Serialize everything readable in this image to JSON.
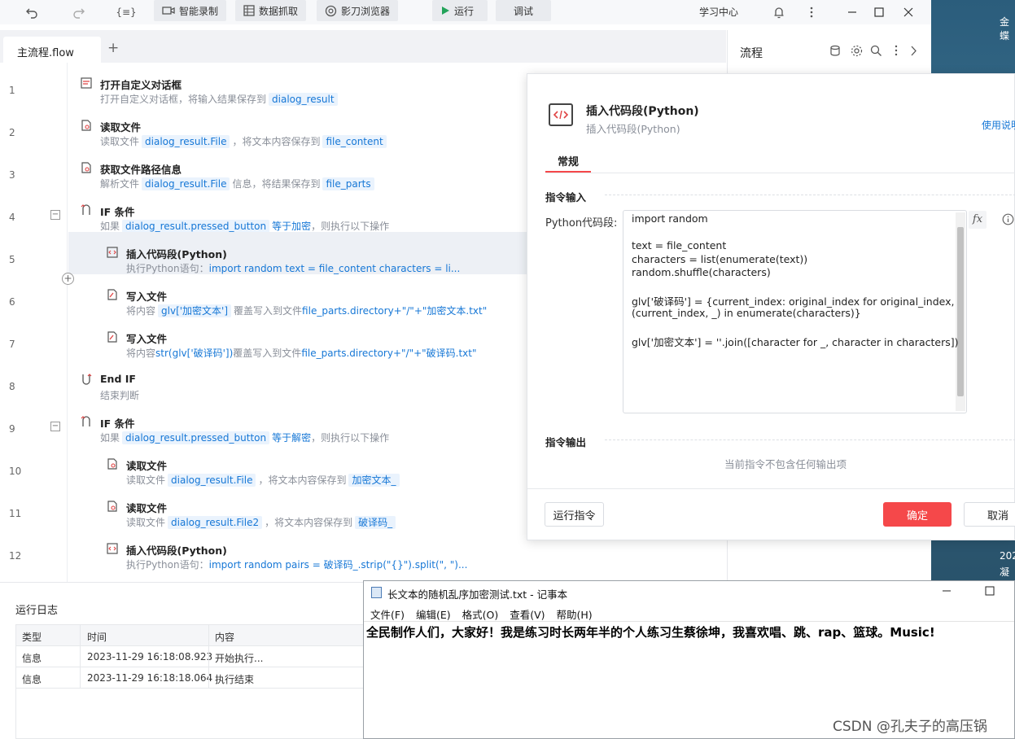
{
  "toolbar": {
    "btn_record": "智能录制",
    "btn_capture": "数据抓取",
    "btn_browser": "影刀浏览器",
    "btn_run": "运行",
    "btn_debug": "调试",
    "learning_center": "学习中心",
    "var_icon_label": "{≡}"
  },
  "tabs": {
    "active": "主流程.flow",
    "add": "+"
  },
  "flow": {
    "rows": [
      {
        "num": "1",
        "title": "打开自定义对话框",
        "d1": "打开自定义对话框，将输入结果保存到",
        "v1": "dialog_result"
      },
      {
        "num": "2",
        "title": "读取文件",
        "d1": "读取文件",
        "v1": "dialog_result.File",
        "d2": "，将文本内容保存到",
        "v2": "file_content"
      },
      {
        "num": "3",
        "title": "获取文件路径信息",
        "d1": "解析文件",
        "v1": "dialog_result.File",
        "d2": "信息，将结果保存到",
        "v2": "file_parts"
      },
      {
        "num": "4",
        "title": "IF 条件",
        "d1": "如果",
        "v1": "dialog_result.pressed_button",
        "k1": "等于加密",
        "d2": "，则执行以下操作"
      },
      {
        "num": "5",
        "title": "插入代码段(Python)",
        "d1": "执行Python语句：",
        "k1": "import random  text = file_content characters = li..."
      },
      {
        "num": "6",
        "title": "写入文件",
        "d1": "将内容",
        "v1": "glv['加密文本']",
        "d2": "覆盖写入到文件",
        "k1": "file_parts.directory+\"/\"+\"加密文本.txt\""
      },
      {
        "num": "7",
        "title": "写入文件",
        "d1": "将内容",
        "k1": "str(glv['破译码'])",
        "d2": "覆盖写入到文件",
        "k2": "file_parts.directory+\"/\"+\"破译码.txt\""
      },
      {
        "num": "8",
        "title": "End IF",
        "d1": "结束判断"
      },
      {
        "num": "9",
        "title": "IF 条件",
        "d1": "如果",
        "v1": "dialog_result.pressed_button",
        "k1": "等于解密",
        "d2": "，则执行以下操作"
      },
      {
        "num": "10",
        "title": "读取文件",
        "d1": "读取文件",
        "v1": "dialog_result.File",
        "d2": "，将文本内容保存到",
        "v2": "加密文本_"
      },
      {
        "num": "11",
        "title": "读取文件",
        "d1": "读取文件",
        "v1": "dialog_result.File2",
        "d2": "，将文本内容保存到",
        "v2": "破译码_"
      },
      {
        "num": "12",
        "title": "插入代码段(Python)",
        "d1": "执行Python语句：",
        "k1": "import random pairs = 破译码_.strip(\"{}\").split(\", \")..."
      }
    ]
  },
  "right_panel": {
    "title": "流程"
  },
  "dialog": {
    "title": "插入代码段(Python)",
    "subtitle": "插入代码段(Python)",
    "help_link": "使用说明",
    "tab_general": "常规",
    "section_input": "指令输入",
    "code_label": "Python代码段:",
    "code_lines": [
      "import random",
      "",
      "text = file_content",
      "characters = list(enumerate(text))",
      "random.shuffle(characters)",
      "",
      "glv['破译码'] = {current_index: original_index for original_index,",
      "(current_index, _) in enumerate(characters)}",
      "",
      "glv['加密文本'] = ''.join([character for _, character in characters])"
    ],
    "fx": "fx",
    "section_output": "指令输出",
    "no_output": "当前指令不包含任何输出项",
    "btn_run_cmd": "运行指令",
    "btn_ok": "确定",
    "btn_cancel": "取消"
  },
  "log": {
    "title": "运行日志",
    "headers": [
      "类型",
      "时间",
      "内容"
    ],
    "rows": [
      {
        "type": "信息",
        "time": "2023-11-29 16:18:08.923",
        "content": "开始执行..."
      },
      {
        "type": "信息",
        "time": "2023-11-29 16:18:18.064",
        "content": "执行结束"
      }
    ]
  },
  "notepad": {
    "title": "长文本的随机乱序加密测试.txt - 记事本",
    "menus": [
      "文件(F)",
      "编辑(E)",
      "格式(O)",
      "查看(V)",
      "帮助(H)"
    ],
    "content": "全民制作人们，大家好！我是练习时长两年半的个人练习生蔡徐坤，我喜欢唱、跳、rap、篮球。Music!"
  },
  "desktop": {
    "top_text": "金蝶",
    "bottom_text1": "202",
    "bottom_text2": "凝血"
  },
  "watermark": "CSDN @孔夫子的高压锅",
  "colors": {
    "accent": "#1677d6",
    "danger": "#f5484a",
    "run_green": "#23a35a"
  }
}
